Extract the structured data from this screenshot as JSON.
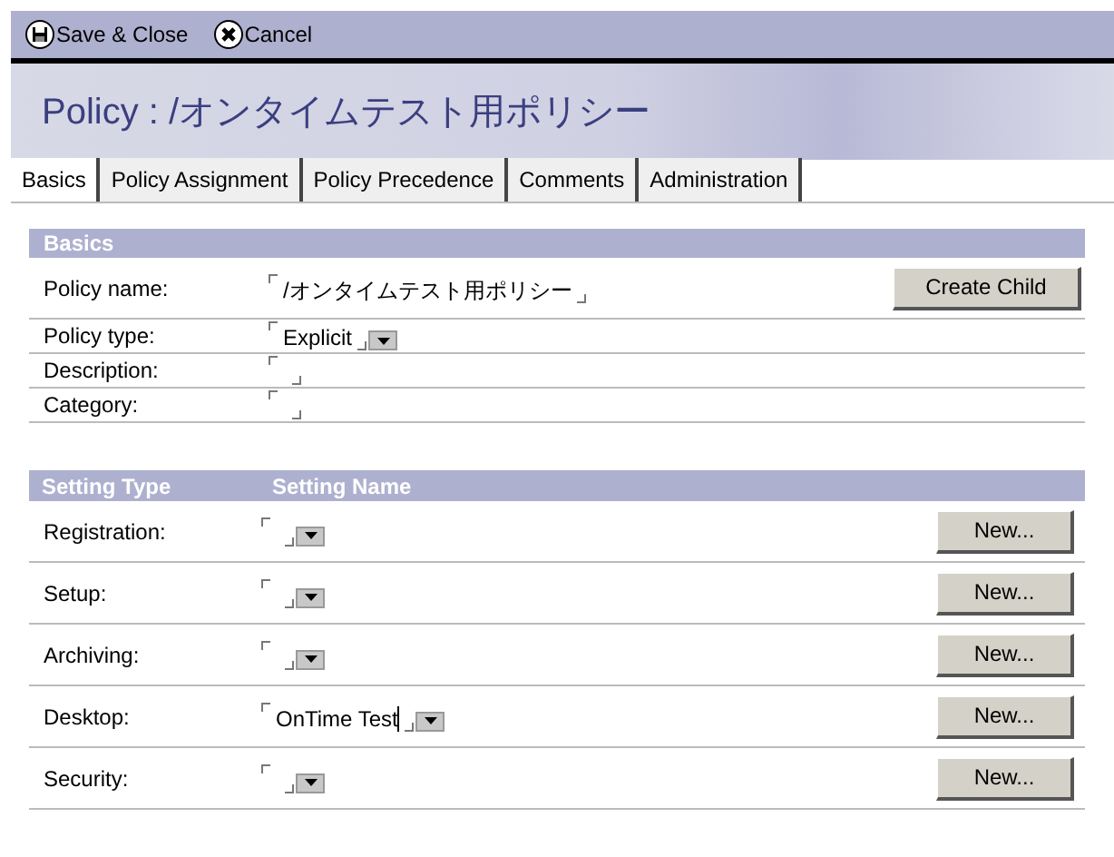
{
  "toolbar": [
    {
      "kind": "save",
      "label": "Save & Close"
    },
    {
      "kind": "cancel",
      "label": "Cancel"
    }
  ],
  "title": "Policy : /オンタイムテスト用ポリシー",
  "tabs": [
    {
      "label": "Basics",
      "selected": true
    },
    {
      "label": "Policy Assignment",
      "selected": false
    },
    {
      "label": "Policy Precedence",
      "selected": false
    },
    {
      "label": "Comments",
      "selected": false
    },
    {
      "label": "Administration",
      "selected": false
    }
  ],
  "basics": {
    "header": "Basics",
    "rows": [
      {
        "label": "Policy name:",
        "value": "/オンタイムテスト用ポリシー",
        "dropdown": false,
        "button": "Create Child"
      },
      {
        "label": "Policy type:",
        "value": "Explicit",
        "dropdown": true
      },
      {
        "label": "Description:",
        "dropdown": false
      },
      {
        "label": "Category:",
        "dropdown": false
      }
    ]
  },
  "settings": {
    "columns": [
      "Setting Type",
      "Setting Name"
    ],
    "rows": [
      {
        "label": "Registration:",
        "button": "New..."
      },
      {
        "label": "Setup:",
        "button": "New..."
      },
      {
        "label": "Archiving:",
        "button": "New..."
      },
      {
        "label": "Desktop:",
        "value": "OnTime Test",
        "focused": true,
        "button": "New..."
      },
      {
        "label": "Security:",
        "button": "New..."
      }
    ]
  }
}
